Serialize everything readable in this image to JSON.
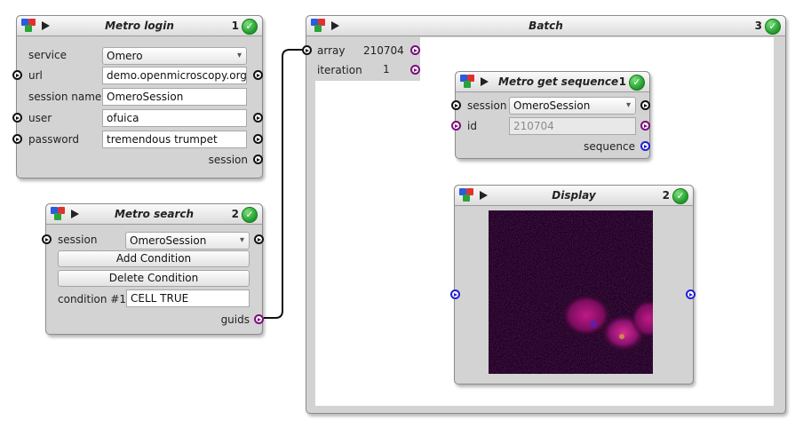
{
  "colors": {
    "accent": "#2aa33a",
    "node_bg": "#d3d3d3",
    "wire_violet": "#7a0d7a",
    "wire_blue": "#1f1fd6"
  },
  "nodes": {
    "login": {
      "title": "Metro login",
      "number": "1",
      "fields": {
        "service_label": "service",
        "service_value": "Omero",
        "url_label": "url",
        "url_value": "demo.openmicroscopy.org",
        "session_name_label": "session name",
        "session_name_value": "OmeroSession",
        "user_label": "user",
        "user_value": "ofuica",
        "password_label": "password",
        "password_value": "tremendous trumpet"
      },
      "output_label": "session"
    },
    "search": {
      "title": "Metro search",
      "number": "2",
      "session_label": "session",
      "session_value": "OmeroSession",
      "add_condition": "Add Condition",
      "delete_condition": "Delete Condition",
      "condition_label": "condition #1",
      "condition_value": "CELL TRUE",
      "output_label": "guids"
    },
    "batch": {
      "title": "Batch",
      "number": "3",
      "array_label": "array",
      "array_value": "210704",
      "iteration_label": "iteration",
      "iteration_value": "1"
    },
    "get_sequence": {
      "title": "Metro get sequence",
      "number": "1",
      "session_label": "session",
      "session_value": "OmeroSession",
      "id_label": "id",
      "id_value": "210704",
      "output_label": "sequence"
    },
    "display": {
      "title": "Display",
      "number": "2"
    }
  },
  "icons": {
    "check": "✓",
    "caret": "▾",
    "play": "play-icon",
    "blocks": "blocks-icon"
  }
}
